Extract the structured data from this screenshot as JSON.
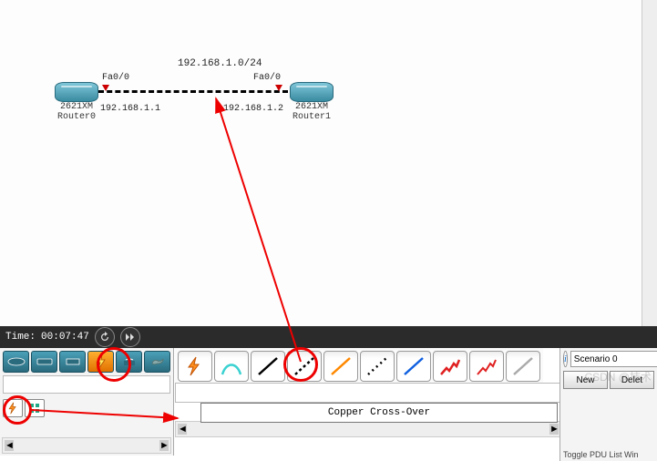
{
  "topology": {
    "subnet": "192.168.1.0/24",
    "router0": {
      "model": "2621XM",
      "name": "Router0",
      "iface": "Fa0/0",
      "ip": "192.168.1.1"
    },
    "router1": {
      "model": "2621XM",
      "name": "Router1",
      "iface": "Fa0/0",
      "ip": "192.168.1.2"
    }
  },
  "sim": {
    "time_label": "Time:",
    "time_value": "00:07:47"
  },
  "cables": {
    "tooltip": "Copper Cross-Over"
  },
  "scenario": {
    "current": "Scenario 0",
    "new_btn": "New",
    "delete_btn": "Delet",
    "footer": "Toggle PDU List Win"
  },
  "watermark": "CSDN @技术"
}
